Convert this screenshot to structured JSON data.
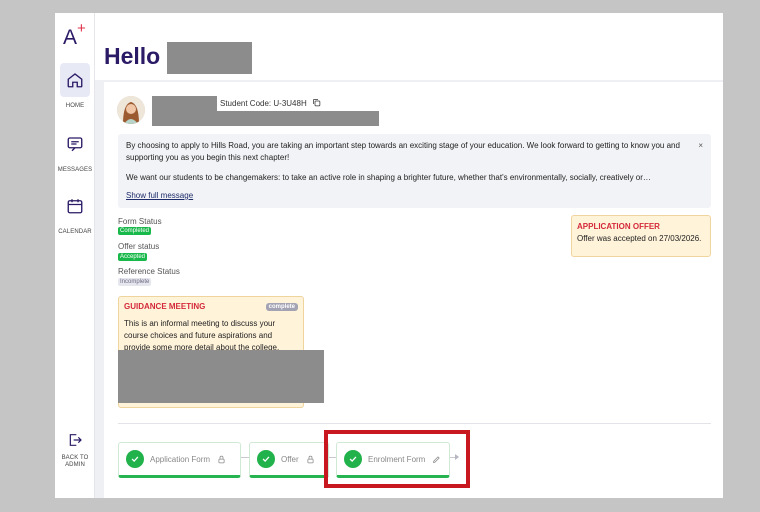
{
  "sidebar": {
    "logo": "A",
    "logo_plus": "+",
    "items": [
      {
        "label": "HOME",
        "icon": "home-icon",
        "active": true
      },
      {
        "label": "MESSAGES",
        "icon": "message-icon",
        "active": false
      },
      {
        "label": "CALENDAR",
        "icon": "calendar-icon",
        "active": false
      }
    ],
    "back_label_1": "BACK TO",
    "back_label_2": "ADMIN"
  },
  "header": {
    "greeting": "Hello"
  },
  "student": {
    "code_label": "Student Code: U-3U48H"
  },
  "message": {
    "para1": "By choosing to apply to Hills Road, you are taking an important step towards an exciting stage of your education. We look forward to getting to know you and supporting you as you begin this next chapter!",
    "para2": "We want our students to be changemakers: to take an active role in shaping a brighter future, whether that's environmentally, socially, creatively or…",
    "show_full": "Show full message",
    "close": "×"
  },
  "statuses": [
    {
      "label": "Form Status",
      "badge": "Completed"
    },
    {
      "label": "Offer status",
      "badge": "Accepted"
    },
    {
      "label": "Reference Status",
      "badge": "Incomplete"
    }
  ],
  "offer": {
    "title": "APPLICATION OFFER",
    "text": "Offer was accepted on 27/03/2026."
  },
  "guidance": {
    "title": "GUIDANCE MEETING",
    "badge": "complete",
    "text": "This is an informal meeting to discuss your course choices and future aspirations and provide some more detail about the college."
  },
  "steps": [
    {
      "label": "Application Form",
      "icon": "lock-icon"
    },
    {
      "label": "Offer",
      "icon": "lock-icon"
    },
    {
      "label": "Enrolment Form",
      "icon": "pencil-icon"
    }
  ],
  "colors": {
    "brand": "#2b1a66",
    "accent_red": "#d42a3a",
    "success": "#22b24c",
    "highlight": "#c8171e"
  }
}
